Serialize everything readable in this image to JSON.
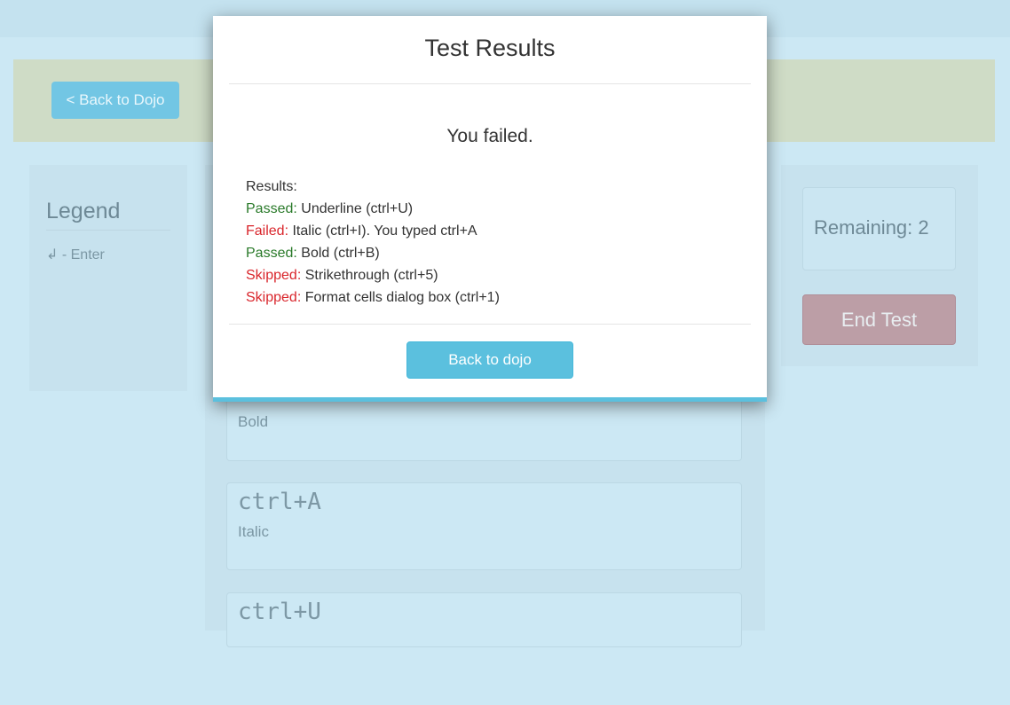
{
  "banner": {
    "back_button": "< Back to Dojo"
  },
  "legend": {
    "title": "Legend",
    "enter_symbol": "↲",
    "enter_label": "- Enter"
  },
  "cards": [
    {
      "shortcut": "",
      "label": "Bold"
    },
    {
      "shortcut": "ctrl+A",
      "label": "Italic"
    },
    {
      "shortcut": "ctrl+U",
      "label": ""
    }
  ],
  "sidebar": {
    "remaining_label": "Remaining:",
    "remaining_count": "2",
    "end_button": "End Test"
  },
  "modal": {
    "title": "Test Results",
    "message": "You failed.",
    "results_heading": "Results:",
    "results": [
      {
        "status": "Passed:",
        "status_type": "passed",
        "text": "Underline (ctrl+U)"
      },
      {
        "status": "Failed:",
        "status_type": "failed",
        "text": "Italic (ctrl+I). You typed ctrl+A"
      },
      {
        "status": "Passed:",
        "status_type": "passed",
        "text": "Bold (ctrl+B)"
      },
      {
        "status": "Skipped:",
        "status_type": "failed",
        "text": "Strikethrough (ctrl+5)"
      },
      {
        "status": "Skipped:",
        "status_type": "failed",
        "text": "Format cells dialog box (ctrl+1)"
      }
    ],
    "button": "Back to dojo"
  },
  "colors": {
    "background": "#cce8f4",
    "banner": "#cfdcc6",
    "accent": "#5bc0de",
    "passed": "#2a7a2a",
    "failed": "#d9262c",
    "end_button": "#bc9ea6"
  }
}
